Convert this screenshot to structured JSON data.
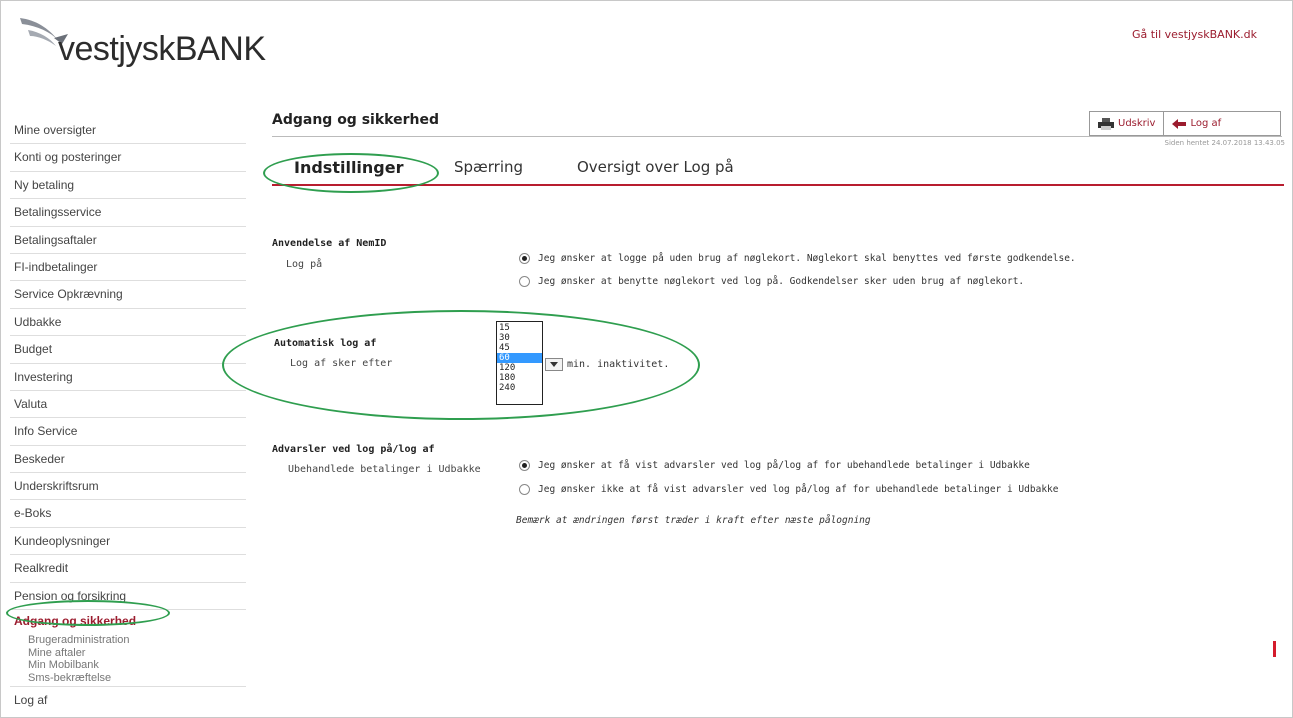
{
  "header": {
    "logo_text": "vestjyskBANK",
    "goto_link": "Gå til vestjyskBANK.dk"
  },
  "sidebar": {
    "items": [
      {
        "label": "Mine oversigter"
      },
      {
        "label": "Konti og posteringer"
      },
      {
        "label": "Ny betaling"
      },
      {
        "label": "Betalingsservice"
      },
      {
        "label": "Betalingsaftaler"
      },
      {
        "label": "FI-indbetalinger"
      },
      {
        "label": "Service Opkrævning"
      },
      {
        "label": "Udbakke"
      },
      {
        "label": "Budget"
      },
      {
        "label": "Investering"
      },
      {
        "label": "Valuta"
      },
      {
        "label": "Info Service"
      },
      {
        "label": "Beskeder"
      },
      {
        "label": "Underskriftsrum"
      },
      {
        "label": "e-Boks"
      },
      {
        "label": "Kundeoplysninger"
      },
      {
        "label": "Realkredit"
      },
      {
        "label": "Pension og forsikring"
      }
    ],
    "active_item": "Adgang og sikkerhed",
    "sub_items": [
      {
        "label": "Brugeradministration"
      },
      {
        "label": "Mine aftaler"
      },
      {
        "label": "Min Mobilbank"
      },
      {
        "label": "Sms-bekræftelse"
      }
    ],
    "last_item": "Log af"
  },
  "main": {
    "title": "Adgang og sikkerhed",
    "toolbar": {
      "print_label": "Udskriv",
      "logout_label": "Log af"
    },
    "last_login": "Siden hentet 24.07.2018 13.43.05",
    "tabs": [
      {
        "label": "Indstillinger",
        "active": true
      },
      {
        "label": "Spærring",
        "active": false
      },
      {
        "label": "Oversigt over Log på",
        "active": false
      }
    ],
    "nemid": {
      "section_title": "Anvendelse af NemID",
      "field_label": "Log på",
      "options": [
        {
          "label": "Jeg ønsker at logge på uden brug af nøglekort. Nøglekort skal benyttes ved første godkendelse.",
          "checked": true
        },
        {
          "label": "Jeg ønsker at benytte nøglekort ved log på. Godkendelser sker uden brug af nøglekort.",
          "checked": false
        }
      ]
    },
    "autologout": {
      "section_title": "Automatisk log af",
      "field_label": "Log af sker efter",
      "options": [
        "15",
        "30",
        "45",
        "60",
        "120",
        "180",
        "240"
      ],
      "selected": "60",
      "unit_text": "min. inaktivitet."
    },
    "warnings": {
      "section_title": "Advarsler ved log på/log af",
      "field_label": "Ubehandlede betalinger i Udbakke",
      "options": [
        {
          "label": "Jeg ønsker at få vist advarsler ved log på/log af for ubehandlede betalinger i Udbakke",
          "checked": true
        },
        {
          "label": "Jeg ønsker ikke at få vist advarsler ved log på/log af for ubehandlede betalinger i Udbakke",
          "checked": false
        }
      ],
      "note": "Bemærk at ændringen først træder i kraft efter næste pålogning"
    }
  },
  "colors": {
    "accent": "#9b1c2e",
    "tab_underline": "#b81d2f",
    "highlight_oval": "#2f9e4f",
    "selected_option": "#3399ff"
  }
}
